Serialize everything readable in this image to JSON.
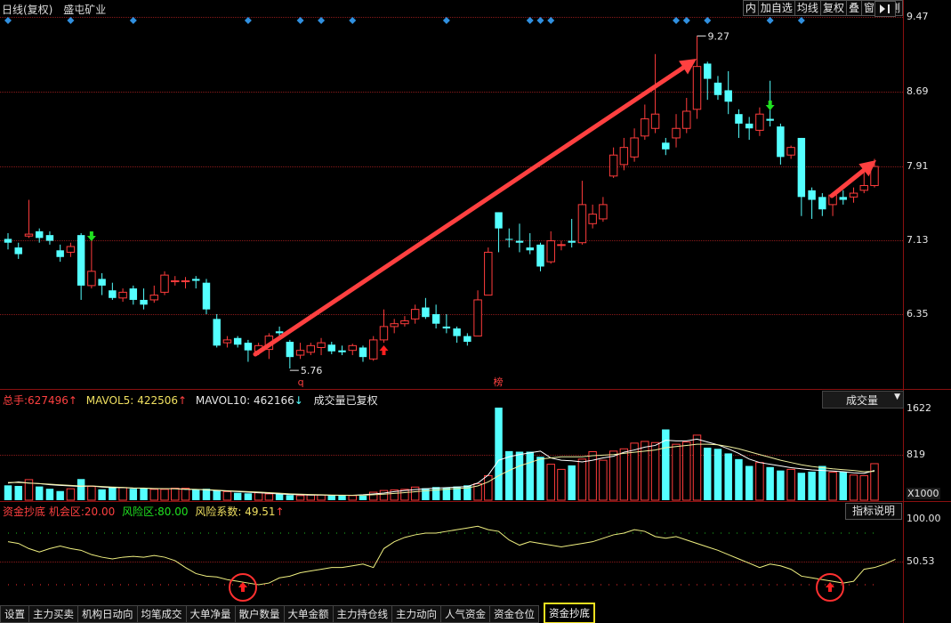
{
  "header": {
    "title": "日线(复权)",
    "stock_name": "盛屯矿业",
    "toolbar": [
      "内",
      "加自选",
      "均线",
      "复权",
      "叠",
      "窗",
      "预测"
    ],
    "nav_icon": "play-exit-icon"
  },
  "price_panel": {
    "y_ticks": [
      "9.47",
      "8.69",
      "7.91",
      "7.13",
      "6.35"
    ],
    "high_label": "9.27",
    "low_label": "5.76",
    "marker_q": "q",
    "marker_bang": "榜"
  },
  "volume_panel": {
    "total_label": "总手:",
    "total_value": "627496",
    "mavol5_label": "MAVOL5:",
    "mavol5_value": "422506",
    "mavol10_label": "MAVOL10:",
    "mavol10_value": "462166",
    "note": "成交量已复权",
    "selector": "成交量",
    "y_ticks": [
      "1622",
      "819"
    ],
    "unit": "X1000"
  },
  "indicator_panel": {
    "name": "资金抄底",
    "opp_label": "机会区:",
    "opp_value": "20.00",
    "risk_label": "风险区:",
    "risk_value": "80.00",
    "coef_label": "风险系数:",
    "coef_value": "49.51",
    "button": "指标说明",
    "y_ticks": [
      "100.00",
      "50.53"
    ]
  },
  "tabs": [
    "设置",
    "主力买卖",
    "机构日动向",
    "均笔成交",
    "大单净量",
    "散户数量",
    "大单金额",
    "主力持仓线",
    "主力动向",
    "人气资金",
    "资金仓位",
    "资金抄底"
  ],
  "active_tab": "资金抄底",
  "colors": {
    "up": "#ff3c3c",
    "down": "#54ffff",
    "ma5": "#ffffff",
    "ma10": "#f0f0a0",
    "indicator": "#f0f080",
    "grid": "#8a1a1a",
    "arrow": "#ff4040",
    "buy": "#ff2020",
    "sell": "#20e020",
    "diamond": "#3090e0"
  },
  "chart_data": [
    {
      "type": "candlestick",
      "ylim": [
        5.6,
        9.55
      ],
      "y_ticks": [
        9.47,
        8.69,
        7.91,
        7.13,
        6.35
      ],
      "candles": [
        [
          7.14,
          7.1,
          7.2,
          7.03
        ],
        [
          7.05,
          6.98,
          7.1,
          6.93
        ],
        [
          7.17,
          7.19,
          7.55,
          7.15
        ],
        [
          7.22,
          7.15,
          7.25,
          7.1
        ],
        [
          7.18,
          7.12,
          7.22,
          7.08
        ],
        [
          7.02,
          6.95,
          7.08,
          6.9
        ],
        [
          7.0,
          7.06,
          7.1,
          6.95
        ],
        [
          7.18,
          6.65,
          7.2,
          6.5
        ],
        [
          6.65,
          6.8,
          7.18,
          6.62
        ],
        [
          6.72,
          6.65,
          6.78,
          6.55
        ],
        [
          6.6,
          6.52,
          6.68,
          6.5
        ],
        [
          6.52,
          6.58,
          6.62,
          6.48
        ],
        [
          6.62,
          6.5,
          6.65,
          6.45
        ],
        [
          6.5,
          6.45,
          6.62,
          6.4
        ],
        [
          6.5,
          6.55,
          6.65,
          6.47
        ],
        [
          6.58,
          6.76,
          6.8,
          6.55
        ],
        [
          6.7,
          6.7,
          6.75,
          6.65
        ],
        [
          6.7,
          6.7,
          6.74,
          6.62
        ],
        [
          6.72,
          6.7,
          6.75,
          6.62
        ],
        [
          6.68,
          6.4,
          6.72,
          6.35
        ],
        [
          6.3,
          6.02,
          6.35,
          6.0
        ],
        [
          6.05,
          6.08,
          6.12,
          6.0
        ],
        [
          6.1,
          6.03,
          6.12,
          6.0
        ],
        [
          6.05,
          5.97,
          6.08,
          5.85
        ],
        [
          5.96,
          6.02,
          6.05,
          5.92
        ],
        [
          5.98,
          6.12,
          6.15,
          5.88
        ],
        [
          6.17,
          6.15,
          6.22,
          6.1
        ],
        [
          6.06,
          5.9,
          6.08,
          5.78
        ],
        [
          5.92,
          5.97,
          6.05,
          5.88
        ],
        [
          5.95,
          6.02,
          6.05,
          5.92
        ],
        [
          6.0,
          6.05,
          6.1,
          5.92
        ],
        [
          6.03,
          5.96,
          6.06,
          5.93
        ],
        [
          5.97,
          5.95,
          6.02,
          5.92
        ],
        [
          5.97,
          6.02,
          6.04,
          5.92
        ],
        [
          6.0,
          5.9,
          6.02,
          5.85
        ],
        [
          5.88,
          6.08,
          6.12,
          5.86
        ],
        [
          6.08,
          6.22,
          6.4,
          6.05
        ],
        [
          6.22,
          6.25,
          6.3,
          6.15
        ],
        [
          6.25,
          6.28,
          6.33,
          6.22
        ],
        [
          6.3,
          6.4,
          6.45,
          6.25
        ],
        [
          6.42,
          6.32,
          6.52,
          6.3
        ],
        [
          6.35,
          6.25,
          6.45,
          6.2
        ],
        [
          6.22,
          6.2,
          6.35,
          6.15
        ],
        [
          6.2,
          6.12,
          6.22,
          6.05
        ],
        [
          6.12,
          6.06,
          6.15,
          6.02
        ],
        [
          6.12,
          6.5,
          6.6,
          6.12
        ],
        [
          6.55,
          7.0,
          7.05,
          6.55
        ],
        [
          7.42,
          7.25,
          7.42,
          7.0
        ],
        [
          7.14,
          7.13,
          7.25,
          7.05
        ],
        [
          7.12,
          7.1,
          7.3,
          7.0
        ],
        [
          7.05,
          7.02,
          7.2,
          6.98
        ],
        [
          7.08,
          6.85,
          7.1,
          6.8
        ],
        [
          6.9,
          7.12,
          7.22,
          6.88
        ],
        [
          7.08,
          7.08,
          7.12,
          7.02
        ],
        [
          7.12,
          7.1,
          7.35,
          7.05
        ],
        [
          7.1,
          7.5,
          7.75,
          7.08
        ],
        [
          7.3,
          7.4,
          7.5,
          7.25
        ],
        [
          7.35,
          7.5,
          7.58,
          7.32
        ],
        [
          7.8,
          8.02,
          8.1,
          7.78
        ],
        [
          7.92,
          8.1,
          8.2,
          7.86
        ],
        [
          8.0,
          8.2,
          8.3,
          7.95
        ],
        [
          8.22,
          8.4,
          8.55,
          8.18
        ],
        [
          8.3,
          8.45,
          9.08,
          8.25
        ],
        [
          8.15,
          8.08,
          8.2,
          8.02
        ],
        [
          8.2,
          8.3,
          8.45,
          8.1
        ],
        [
          8.3,
          8.48,
          8.62,
          8.25
        ],
        [
          8.5,
          8.95,
          9.27,
          8.4
        ],
        [
          8.98,
          8.82,
          9.0,
          8.6
        ],
        [
          8.78,
          8.65,
          8.85,
          8.6
        ],
        [
          8.7,
          8.58,
          8.9,
          8.45
        ],
        [
          8.45,
          8.35,
          8.5,
          8.2
        ],
        [
          8.35,
          8.3,
          8.42,
          8.18
        ],
        [
          8.28,
          8.45,
          8.52,
          8.22
        ],
        [
          8.4,
          8.38,
          8.8,
          8.32
        ],
        [
          8.32,
          8.0,
          8.35,
          7.92
        ],
        [
          8.02,
          8.1,
          8.12,
          7.98
        ],
        [
          8.2,
          7.58,
          8.2,
          7.38
        ],
        [
          7.65,
          7.55,
          7.68,
          7.35
        ],
        [
          7.58,
          7.45,
          7.62,
          7.38
        ],
        [
          7.5,
          7.6,
          7.62,
          7.38
        ],
        [
          7.58,
          7.55,
          7.65,
          7.5
        ],
        [
          7.58,
          7.62,
          7.68,
          7.52
        ],
        [
          7.65,
          7.7,
          7.85,
          7.62
        ],
        [
          7.7,
          7.9,
          7.98,
          7.68
        ]
      ],
      "high": 9.27,
      "low": 5.76
    },
    {
      "type": "bar",
      "ylim": [
        0,
        1700
      ],
      "y_ticks": [
        1622,
        819
      ],
      "values": [
        260,
        250,
        360,
        240,
        200,
        160,
        200,
        370,
        240,
        190,
        230,
        220,
        200,
        210,
        190,
        190,
        210,
        210,
        190,
        200,
        180,
        150,
        130,
        120,
        130,
        110,
        110,
        90,
        80,
        90,
        90,
        80,
        90,
        80,
        80,
        140,
        170,
        180,
        190,
        230,
        210,
        230,
        220,
        240,
        260,
        290,
        430,
        1622,
        860,
        850,
        850,
        760,
        630,
        540,
        610,
        720,
        850,
        700,
        860,
        900,
        1000,
        1030,
        1010,
        1240,
        980,
        1020,
        1140,
        920,
        900,
        820,
        720,
        600,
        660,
        580,
        520,
        540,
        480,
        500,
        600,
        490,
        500,
        440,
        430,
        640
      ],
      "mavol5": [
        300,
        320,
        300,
        290,
        270,
        260,
        250,
        240,
        250,
        230,
        220,
        220,
        210,
        210,
        200,
        200,
        200,
        190,
        190,
        180,
        170,
        160,
        150,
        140,
        130,
        120,
        110,
        100,
        95,
        90,
        90,
        85,
        85,
        85,
        95,
        110,
        125,
        150,
        170,
        185,
        200,
        210,
        220,
        230,
        240,
        300,
        440,
        700,
        760,
        800,
        830,
        860,
        740,
        700,
        690,
        670,
        700,
        740,
        770,
        840,
        880,
        930,
        960,
        1050,
        1040,
        1040,
        1070,
        1020,
        970,
        900,
        820,
        720,
        660,
        630,
        600,
        570,
        550,
        530,
        520,
        510,
        500,
        480,
        470,
        520
      ],
      "mavol10": [
        310,
        310,
        300,
        290,
        280,
        270,
        260,
        250,
        250,
        240,
        230,
        225,
        215,
        212,
        205,
        202,
        200,
        195,
        190,
        185,
        175,
        165,
        158,
        150,
        142,
        132,
        122,
        112,
        105,
        100,
        95,
        90,
        88,
        86,
        88,
        95,
        105,
        118,
        132,
        148,
        165,
        178,
        192,
        205,
        215,
        250,
        320,
        430,
        520,
        600,
        660,
        720,
        740,
        760,
        760,
        760,
        780,
        790,
        800,
        820,
        840,
        860,
        880,
        920,
        940,
        960,
        980,
        980,
        970,
        940,
        900,
        850,
        800,
        750,
        700,
        660,
        620,
        590,
        570,
        550,
        535,
        520,
        500,
        505
      ],
      "unit": "X1000"
    },
    {
      "type": "line",
      "ylim": [
        0,
        100
      ],
      "y_ticks": [
        100.0,
        50.53
      ],
      "opportunity": 20.0,
      "risk": 80.0,
      "values": [
        70,
        68,
        62,
        58,
        62,
        65,
        62,
        60,
        55,
        52,
        50,
        52,
        53,
        52,
        54,
        52,
        48,
        40,
        33,
        30,
        29,
        26,
        24,
        22,
        20,
        22,
        28,
        30,
        34,
        36,
        38,
        40,
        40,
        42,
        44,
        40,
        62,
        70,
        75,
        78,
        80,
        80,
        82,
        84,
        86,
        88,
        84,
        82,
        72,
        66,
        70,
        68,
        66,
        64,
        66,
        68,
        70,
        74,
        78,
        80,
        84,
        82,
        76,
        74,
        76,
        72,
        68,
        64,
        60,
        55,
        50,
        45,
        40,
        44,
        42,
        38,
        30,
        28,
        26,
        24,
        22,
        24,
        38,
        40,
        44,
        49.51
      ]
    }
  ]
}
